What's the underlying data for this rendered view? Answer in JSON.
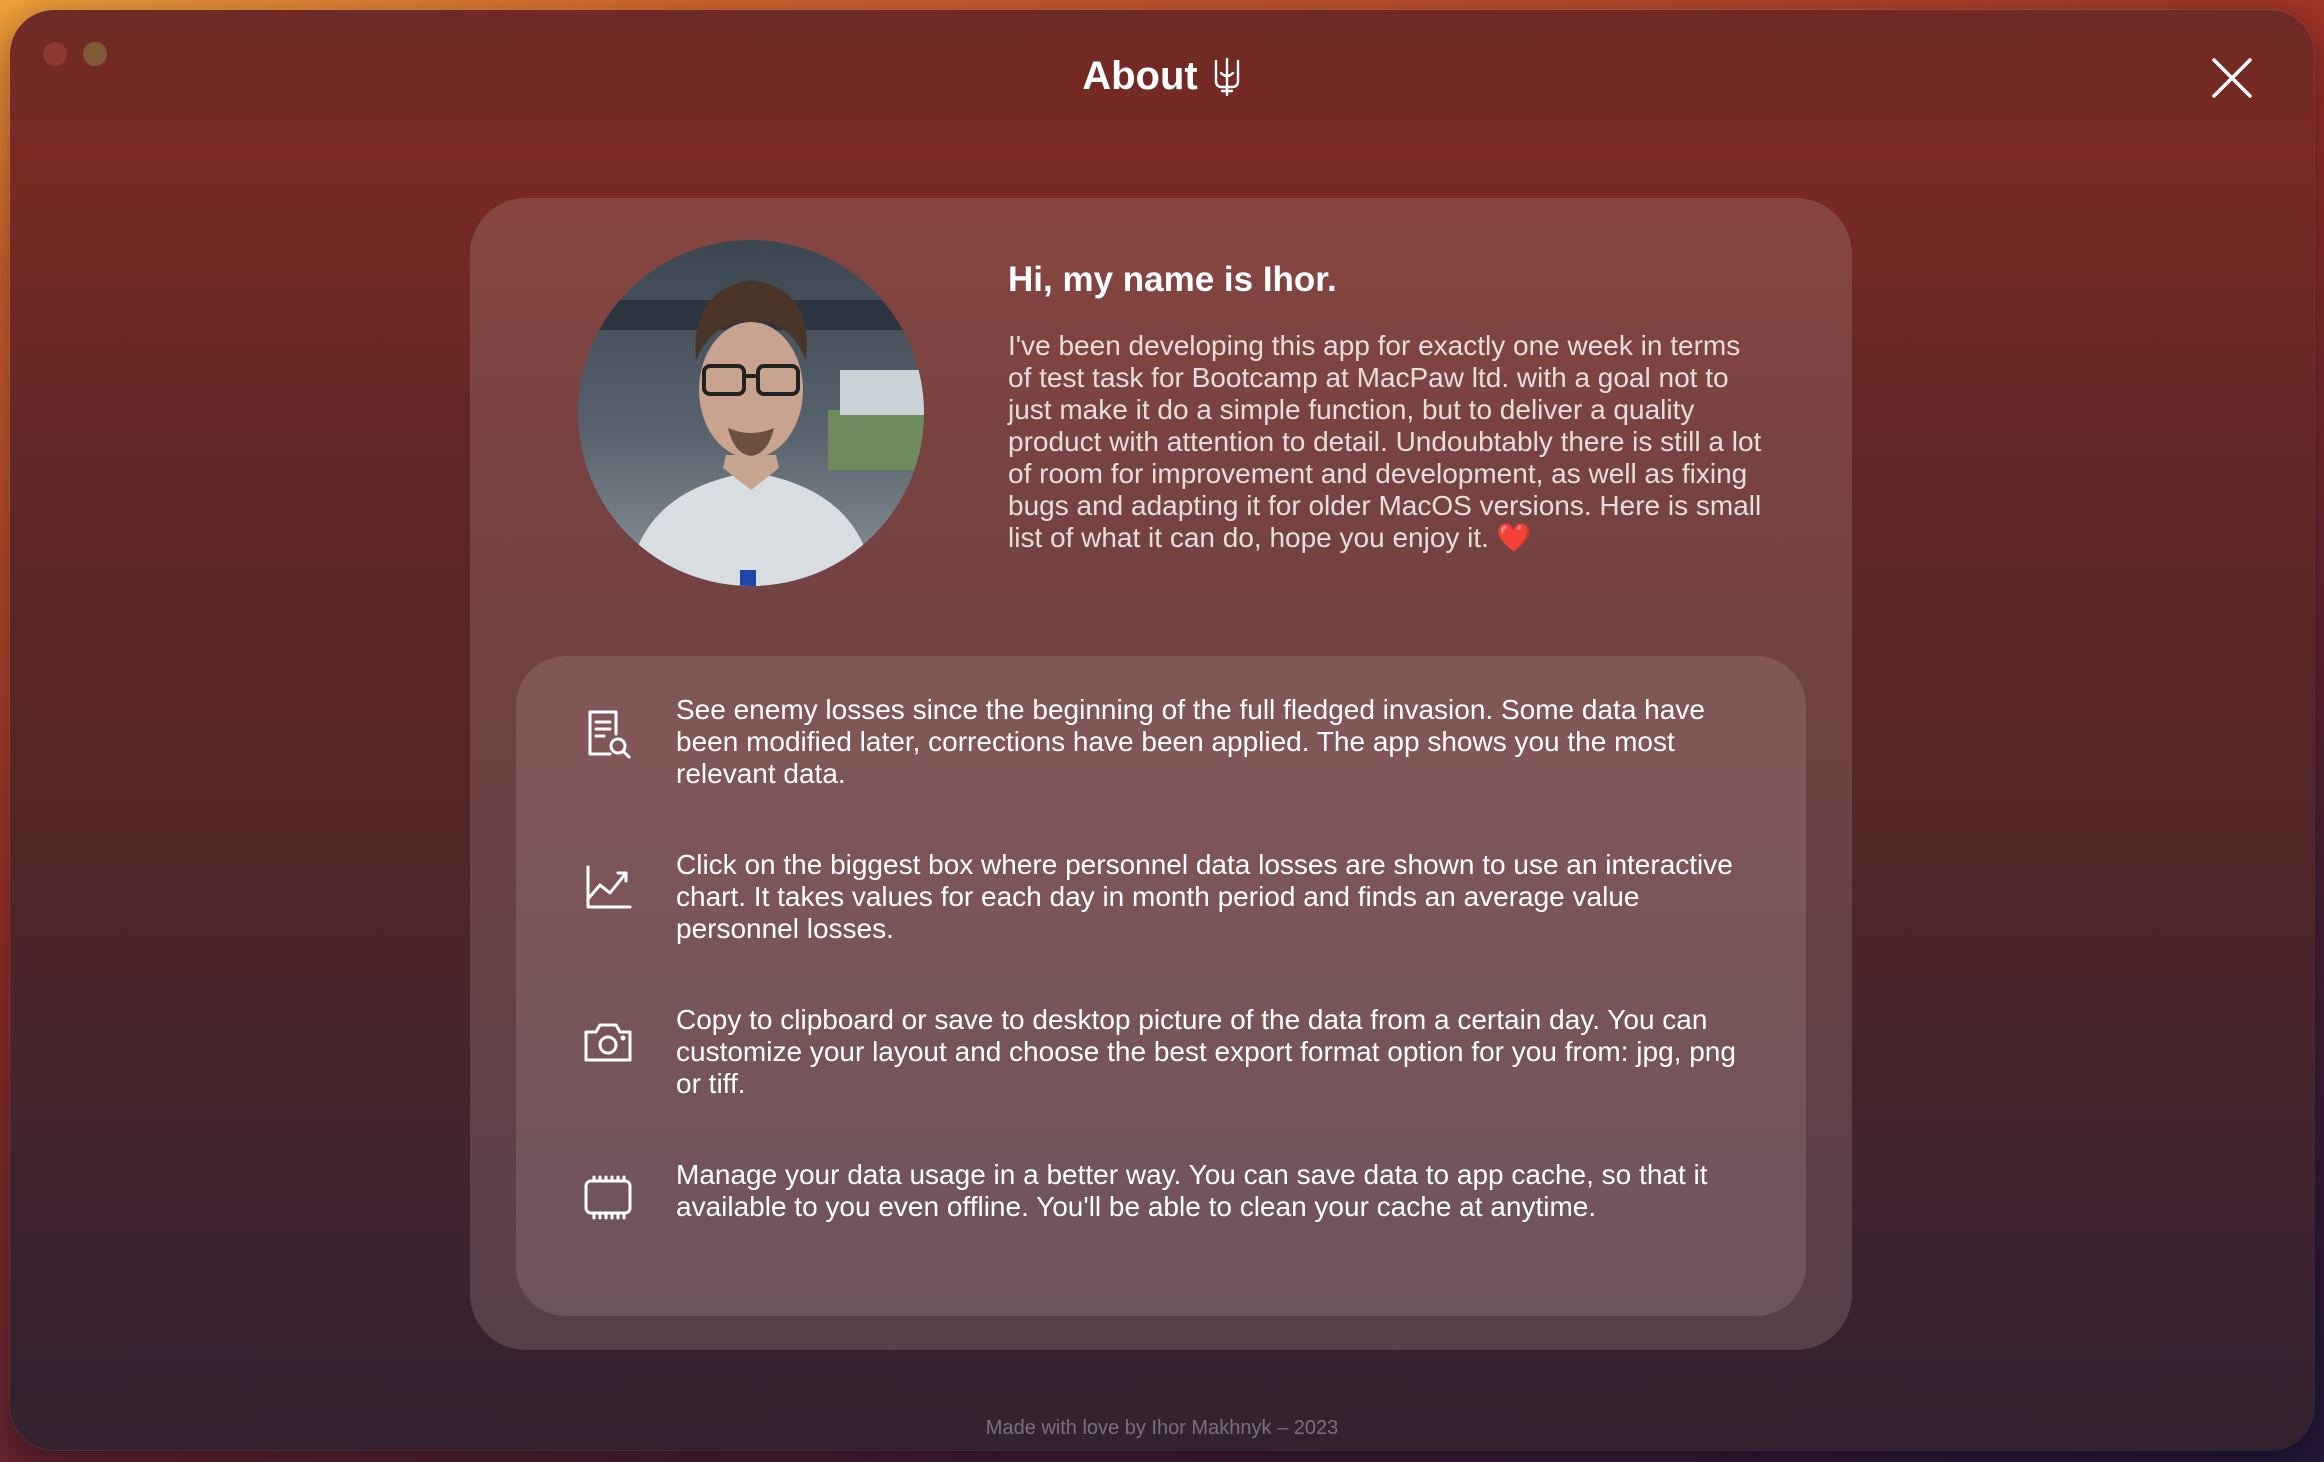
{
  "window": {
    "title": "About",
    "close_label": "Close"
  },
  "intro": {
    "heading": "Hi, my name is Ihor.",
    "body": "I've been developing this app for exactly one week in terms of test task for Bootcamp at MacPaw ltd. with a goal not to just make it do a simple function, but to deliver a quality product with attention to detail. Undoubtably there is still a lot of room for improvement and development, as well as fixing bugs and adapting it for older MacOS versions. Here is small list of what it can do, hope you enjoy it.",
    "heart": "❤️"
  },
  "features": [
    {
      "icon": "document-search-icon",
      "text": "See enemy losses since the beginning of the full fledged invasion. Some data have been modified later, corrections have been applied. The app shows you the most relevant data."
    },
    {
      "icon": "chart-line-icon",
      "text": "Click on the biggest box where personnel data losses are shown to use an interactive chart. It takes values for each day in month period and finds an average value personnel losses."
    },
    {
      "icon": "camera-icon",
      "text": "Copy to clipboard or save to desktop picture of the data from a certain day. You can customize your layout and choose the best export format option for you from: jpg, png or tiff."
    },
    {
      "icon": "memory-chip-icon",
      "text": "Manage your data usage in a better way. You can save data to app cache, so that it available to you even offline. You'll be able to clean your cache at anytime."
    }
  ],
  "footer": "Made with love by Ihor Makhnyk – 2023",
  "colors": {
    "accent": "#ffffff",
    "heart": "#e23a3a",
    "background": "#5a2526"
  }
}
